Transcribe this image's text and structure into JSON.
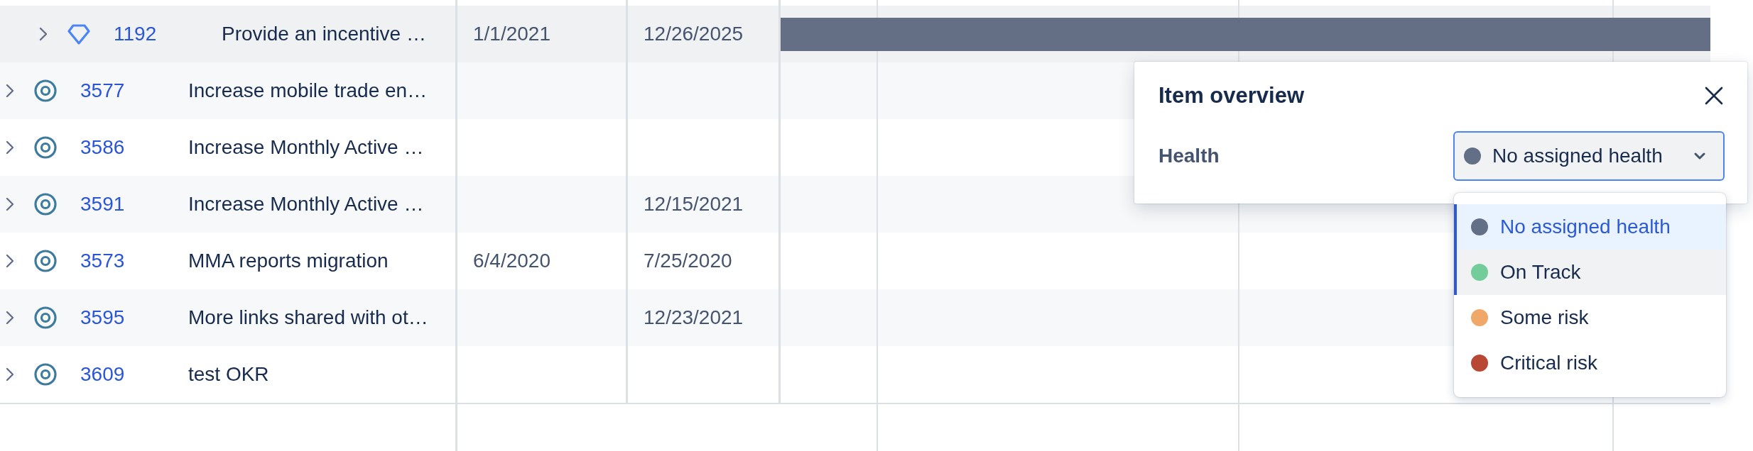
{
  "table": {
    "rows": [
      {
        "kind": "initiative",
        "key": "1192",
        "title": "Provide an incentive …",
        "start": "1/1/2021",
        "end": "12/26/2025",
        "selected": true,
        "expanded": false,
        "bar": true
      },
      {
        "kind": "objective",
        "key": "3577",
        "title": "Increase mobile trade en…",
        "selected": false,
        "expanded": false,
        "bar": false
      },
      {
        "kind": "objective",
        "key": "3586",
        "title": "Increase Monthly Active …",
        "selected": false,
        "expanded": false,
        "bar": false
      },
      {
        "kind": "objective",
        "key": "3591",
        "title": "Increase Monthly Active …",
        "end": "12/15/2021",
        "selected": false,
        "expanded": false,
        "bar": false
      },
      {
        "kind": "objective",
        "key": "3573",
        "title": "MMA reports migration",
        "start": "6/4/2020",
        "end": "7/25/2020",
        "selected": false,
        "expanded": false,
        "bar": false
      },
      {
        "kind": "objective",
        "key": "3595",
        "title": "More links shared with ot…",
        "end": "12/23/2021",
        "selected": false,
        "expanded": false,
        "bar": false
      },
      {
        "kind": "objective",
        "key": "3609",
        "title": "test OKR",
        "selected": false,
        "expanded": false,
        "bar": false
      }
    ]
  },
  "item_overview": {
    "title": "Item overview",
    "health": {
      "label": "Health",
      "value": "No assigned health",
      "options": [
        {
          "label": "No assigned health",
          "color": "#626f86",
          "selected": true,
          "focused": false
        },
        {
          "label": "On Track",
          "color": "#73cd9b",
          "selected": false,
          "focused": true
        },
        {
          "label": "Some risk",
          "color": "#f0a868",
          "selected": false,
          "focused": false
        },
        {
          "label": "Critical risk",
          "color": "#b84834",
          "selected": false,
          "focused": false
        }
      ]
    }
  }
}
